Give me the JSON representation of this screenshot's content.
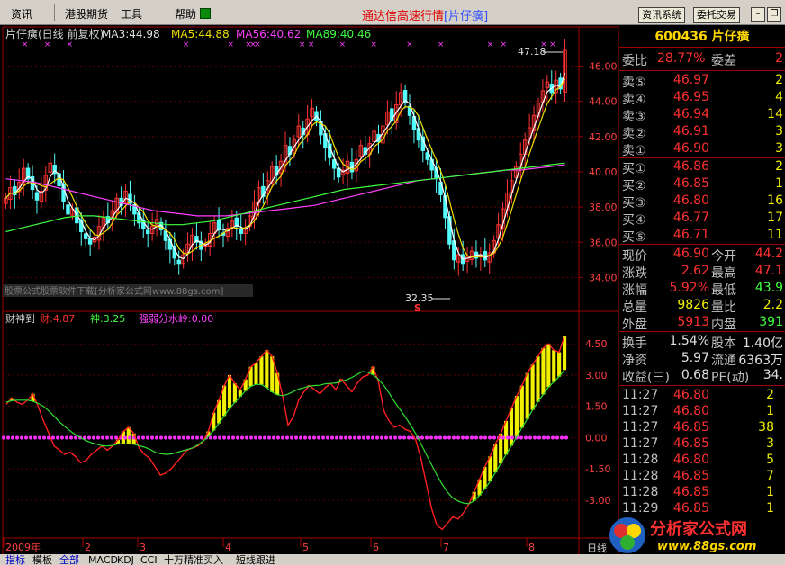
{
  "menubar": {
    "items": [
      "资讯",
      "港股期货",
      "工具",
      "帮助"
    ],
    "center_title": "通达信高速行情",
    "center_title_tag": "[片仔癀]",
    "buttons": [
      "资讯系统",
      "委托交易"
    ]
  },
  "main": {
    "title": "片仔癀(日线 前复权)",
    "ma3": "MA3:44.98",
    "ma5": "MA5:44.88",
    "ma56": "MA56:40.62",
    "ma89": "MA89:40.46",
    "high_label": "47.18",
    "low_label": "32.35",
    "ad_text": "股票公式股票软件下载[分析家公式网www.88gs.com]",
    "s_marker": "S"
  },
  "sub": {
    "title": "财神到",
    "cai": "财:4.87",
    "shen": "神:3.25",
    "sl": "强弱分水岭:0.00"
  },
  "x_axis": [
    "2009年",
    "2",
    "3",
    "4",
    "5",
    "6",
    "7",
    "8"
  ],
  "axis_right_tag": "日线",
  "quote": {
    "code_name": "600436 片仔癀",
    "wei_bi_label": "委比",
    "wei_bi": "28.77%",
    "wei_cha_label": "委差",
    "wei_cha": "2",
    "sell": [
      {
        "label": "卖⑤",
        "price": "46.97",
        "vol": "2"
      },
      {
        "label": "卖④",
        "price": "46.95",
        "vol": "4"
      },
      {
        "label": "卖③",
        "price": "46.94",
        "vol": "14"
      },
      {
        "label": "卖②",
        "price": "46.91",
        "vol": "3"
      },
      {
        "label": "卖①",
        "price": "46.90",
        "vol": "3"
      }
    ],
    "buy": [
      {
        "label": "买①",
        "price": "46.86",
        "vol": "2"
      },
      {
        "label": "买②",
        "price": "46.85",
        "vol": "1"
      },
      {
        "label": "买③",
        "price": "46.80",
        "vol": "16"
      },
      {
        "label": "买④",
        "price": "46.77",
        "vol": "17"
      },
      {
        "label": "买⑤",
        "price": "46.71",
        "vol": "11"
      }
    ],
    "stats": [
      {
        "l1": "现价",
        "v1": "46.90",
        "l2": "今开",
        "v2": "44.2"
      },
      {
        "l1": "涨跌",
        "v1": "2.62",
        "l2": "最高",
        "v2": "47.1"
      },
      {
        "l1": "涨幅",
        "v1": "5.92%",
        "l2": "最低",
        "v2": "43.9"
      },
      {
        "l1": "总量",
        "v1": "9826",
        "l2": "量比",
        "v2": "2.2"
      },
      {
        "l1": "外盘",
        "v1": "5913",
        "l2": "内盘",
        "v2": "391"
      }
    ],
    "stats2": [
      {
        "l1": "换手",
        "v1": "1.54%",
        "l2": "股本",
        "v2": "1.40亿"
      },
      {
        "l1": "净资",
        "v1": "5.97",
        "l2": "流通",
        "v2": "6363万"
      },
      {
        "l1": "收益(三)",
        "v1": "0.68",
        "l2": "PE(动)",
        "v2": "34."
      }
    ],
    "ticks": [
      {
        "t": "11:27",
        "p": "46.80",
        "v": "2"
      },
      {
        "t": "11:27",
        "p": "46.80",
        "v": "1"
      },
      {
        "t": "11:27",
        "p": "46.85",
        "v": "38"
      },
      {
        "t": "11:27",
        "p": "46.85",
        "v": "3"
      },
      {
        "t": "11:28",
        "p": "46.80",
        "v": "5"
      },
      {
        "t": "11:28",
        "p": "46.85",
        "v": "7"
      },
      {
        "t": "11:28",
        "p": "46.85",
        "v": "1"
      },
      {
        "t": "11:29",
        "p": "46.85",
        "v": "1"
      }
    ]
  },
  "bottom_tabs": [
    "指标",
    "模板",
    "全部",
    "MACD",
    "KDJ",
    "CCI",
    "十万精准买入",
    "短线跟进"
  ],
  "watermark": {
    "text": "分析家公式网",
    "url": "www.88gs.com"
  },
  "chart_data": {
    "type": "candlestick",
    "price_axis": {
      "ticks": [
        34.0,
        36.0,
        38.0,
        40.0,
        42.0,
        44.0,
        46.0
      ],
      "ylim": [
        33.0,
        47.2
      ]
    },
    "indicator_axis": {
      "ticks": [
        -3.0,
        -1.5,
        0.0,
        1.5,
        3.0,
        4.5
      ],
      "ylim": [
        -4.6,
        5.2
      ]
    },
    "close_series": [
      38.5,
      39.1,
      38.7,
      39.4,
      40.2,
      39.6,
      39.0,
      38.4,
      38.9,
      39.8,
      40.5,
      39.9,
      39.2,
      38.3,
      37.6,
      37.9,
      37.1,
      36.6,
      36.2,
      35.9,
      36.3,
      36.9,
      37.4,
      37.1,
      37.8,
      38.5,
      38.1,
      38.9,
      38.2,
      37.6,
      37.1,
      36.8,
      36.5,
      36.9,
      37.3,
      36.7,
      36.1,
      35.6,
      35.1,
      34.8,
      35.3,
      35.9,
      36.4,
      36.0,
      35.6,
      35.9,
      36.5,
      37.1,
      36.7,
      36.4,
      36.8,
      37.2,
      36.9,
      36.5,
      36.8,
      37.5,
      38.3,
      39.1,
      38.6,
      39.5,
      40.3,
      39.8,
      40.6,
      41.5,
      41.0,
      41.8,
      42.6,
      42.1,
      43.0,
      43.6,
      42.9,
      42.1,
      41.4,
      40.8,
      40.2,
      39.7,
      40.1,
      40.6,
      40.0,
      40.7,
      41.5,
      41.0,
      41.6,
      42.3,
      41.7,
      42.6,
      43.4,
      42.9,
      43.8,
      44.5,
      43.9,
      43.2,
      42.4,
      41.8,
      41.2,
      40.7,
      40.1,
      39.6,
      38.7,
      37.4,
      35.9,
      35.0,
      35.3,
      34.8,
      35.2,
      35.5,
      35.1,
      35.3,
      35.0,
      35.4,
      36.1,
      37.0,
      37.9,
      38.8,
      39.5,
      40.3,
      41.0,
      41.8,
      42.5,
      43.2,
      43.9,
      44.6,
      45.1,
      44.5,
      45.2,
      44.7,
      46.9
    ],
    "ma56_series": [
      39.6,
      39.5,
      39.4,
      39.2,
      39.0,
      38.8,
      38.6,
      38.4,
      38.2,
      38.0,
      37.8,
      37.7,
      37.6,
      37.5,
      37.5,
      37.5,
      37.6,
      37.7,
      37.8,
      37.9,
      38.0,
      38.1,
      38.3,
      38.5,
      38.7,
      38.9,
      39.1,
      39.3,
      39.5,
      39.6,
      39.7,
      39.8,
      39.9,
      40.0,
      40.1,
      40.1,
      40.2,
      40.3,
      40.4
    ],
    "ma89_series": [
      36.6,
      36.8,
      37.0,
      37.2,
      37.4,
      37.5,
      37.5,
      37.4,
      37.3,
      37.2,
      37.1,
      37.0,
      37.0,
      37.1,
      37.2,
      37.4,
      37.6,
      37.8,
      38.0,
      38.2,
      38.4,
      38.6,
      38.8,
      39.0,
      39.1,
      39.2,
      39.3,
      39.4,
      39.5,
      39.6,
      39.7,
      39.8,
      39.9,
      40.0,
      40.1,
      40.2,
      40.3,
      40.4,
      40.5
    ],
    "cai_series": [
      1.6,
      1.9,
      1.7,
      1.6,
      1.8,
      2.1,
      1.5,
      0.8,
      0.2,
      -0.4,
      -0.6,
      -0.8,
      -0.7,
      -0.9,
      -1.2,
      -1.1,
      -0.8,
      -0.6,
      -0.4,
      -0.6,
      -0.4,
      -0.1,
      0.3,
      0.5,
      0.2,
      -0.5,
      -0.8,
      -1.0,
      -1.4,
      -1.8,
      -1.7,
      -1.5,
      -1.2,
      -0.9,
      -0.6,
      -0.5,
      -0.4,
      -0.2,
      0.3,
      1.2,
      1.8,
      2.5,
      3.0,
      2.6,
      2.3,
      2.8,
      3.4,
      3.6,
      3.9,
      4.2,
      3.9,
      3.1,
      2.0,
      0.6,
      1.0,
      1.8,
      2.2,
      2.5,
      2.3,
      2.1,
      2.4,
      2.6,
      2.3,
      2.8,
      2.5,
      2.2,
      2.6,
      2.9,
      3.0,
      3.4,
      2.7,
      1.3,
      0.8,
      0.5,
      0.6,
      0.4,
      0.3,
      -0.1,
      -1.0,
      -2.2,
      -3.4,
      -4.2,
      -4.4,
      -4.1,
      -3.8,
      -3.9,
      -3.6,
      -3.2,
      -2.6,
      -2.0,
      -1.4,
      -0.9,
      -0.3,
      0.2,
      0.8,
      1.4,
      2.0,
      2.5,
      3.1,
      3.5,
      3.9,
      4.3,
      4.5,
      4.2,
      4.1,
      4.87
    ],
    "shen_series": [
      1.7,
      1.8,
      1.8,
      1.8,
      1.7,
      1.5,
      1.2,
      0.8,
      0.5,
      0.2,
      0.0,
      -0.2,
      -0.3,
      -0.4,
      -0.4,
      -0.3,
      -0.3,
      -0.3,
      -0.4,
      -0.5,
      -0.7,
      -0.8,
      -0.8,
      -0.7,
      -0.6,
      -0.5,
      -0.3,
      0.0,
      0.4,
      0.9,
      1.4,
      1.8,
      2.2,
      2.5,
      2.6,
      2.4,
      2.1,
      2.0,
      2.1,
      2.3,
      2.4,
      2.5,
      2.5,
      2.6,
      2.6,
      2.7,
      2.8,
      3.0,
      3.2,
      3.1,
      2.8,
      2.4,
      1.8,
      1.3,
      0.8,
      0.2,
      -0.5,
      -1.2,
      -1.9,
      -2.5,
      -2.9,
      -3.1,
      -3.2,
      -3.0,
      -2.6,
      -2.1,
      -1.5,
      -0.9,
      -0.3,
      0.3,
      0.9,
      1.5,
      2.0,
      2.5,
      2.8,
      3.25
    ]
  }
}
